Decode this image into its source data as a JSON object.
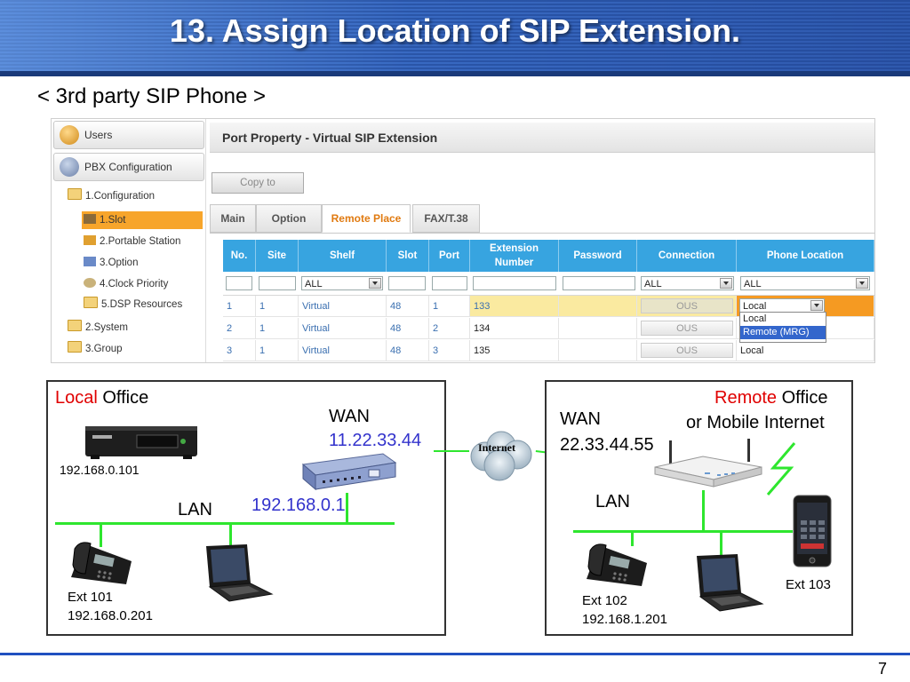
{
  "slide": {
    "title": "13. Assign Location of SIP Extension.",
    "subtitle": "< 3rd party SIP Phone >",
    "page_number": "7"
  },
  "nav": {
    "users": "Users",
    "pbx_configuration": "PBX Configuration",
    "items": [
      {
        "label": "1.Configuration"
      },
      {
        "label": "1.Slot"
      },
      {
        "label": "2.Portable Station"
      },
      {
        "label": "3.Option"
      },
      {
        "label": "4.Clock Priority"
      },
      {
        "label": "5.DSP Resources"
      },
      {
        "label": "2.System"
      },
      {
        "label": "3.Group"
      }
    ]
  },
  "port_property": {
    "title": "Port Property - Virtual SIP Extension",
    "copy_to": "Copy to",
    "tabs": [
      "Main",
      "Option",
      "Remote Place",
      "FAX/T.38"
    ],
    "active_tab": "Remote Place",
    "columns": [
      "No.",
      "Site",
      "Shelf",
      "Slot",
      "Port",
      "Extension Number",
      "Password",
      "Connection",
      "Phone Location"
    ],
    "filters": {
      "shelf": "ALL",
      "connection": "ALL",
      "phone_location": "ALL"
    },
    "rows": [
      {
        "no": "1",
        "site": "1",
        "shelf": "Virtual",
        "slot": "48",
        "port": "1",
        "extension": "133",
        "connection": "OUS",
        "location": "Local"
      },
      {
        "no": "2",
        "site": "1",
        "shelf": "Virtual",
        "slot": "48",
        "port": "2",
        "extension": "134",
        "connection": "OUS",
        "location": ""
      },
      {
        "no": "3",
        "site": "1",
        "shelf": "Virtual",
        "slot": "48",
        "port": "3",
        "extension": "135",
        "connection": "OUS",
        "location": "Local"
      }
    ],
    "dropdown_options": [
      "Local",
      "Remote (MRG)"
    ]
  },
  "diagram": {
    "local_office_word": "Local",
    "office_word": "Office",
    "local_wan_label": "WAN",
    "local_wan_ip": "11.22.33.44",
    "pbx_ip": "192.168.0.101",
    "lan_label_local": "LAN",
    "router_ip": "192.168.0.1",
    "ext101": "Ext 101",
    "ext101_ip": "192.168.0.201",
    "internet": "Internet",
    "remote_word": "Remote",
    "remote_line2": "or Mobile Internet",
    "remote_wan_label": "WAN",
    "remote_wan_ip": "22.33.44.55",
    "lan_label_remote": "LAN",
    "ext102": "Ext 102",
    "ext102_ip": "192.168.1.201",
    "ext103": "Ext 103"
  },
  "colors": {
    "accent_red": "#e00000",
    "accent_blue": "#3333cc",
    "lan_green": "#2ee62e",
    "table_header": "#37a4e0",
    "highlight_orange": "#f7a52b"
  }
}
